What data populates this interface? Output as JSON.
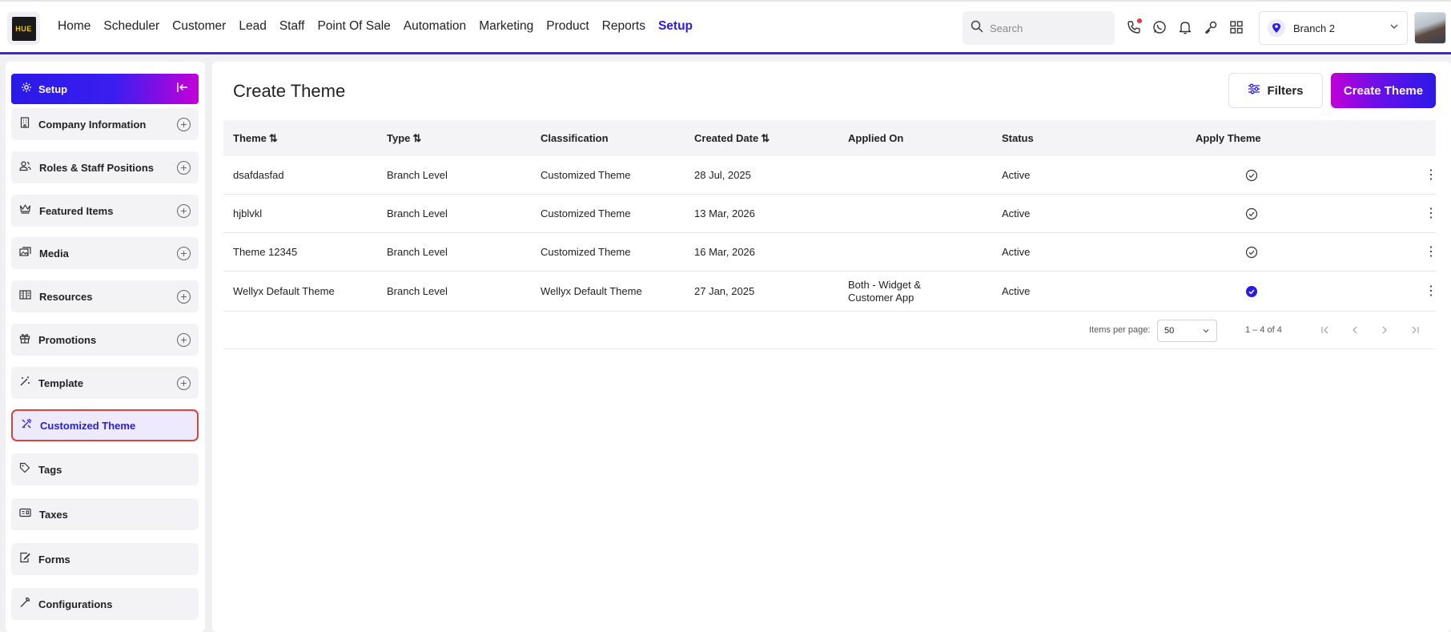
{
  "logo": {
    "text": "HUE"
  },
  "nav": {
    "items": [
      "Home",
      "Scheduler",
      "Customer",
      "Lead",
      "Staff",
      "Point Of Sale",
      "Automation",
      "Marketing",
      "Product",
      "Reports",
      "Setup"
    ],
    "active": "Setup"
  },
  "search": {
    "placeholder": "Search"
  },
  "branch": {
    "label": "Branch 2"
  },
  "sidebar": {
    "header": "Setup",
    "items": [
      {
        "label": "Company Information",
        "icon": "building-icon",
        "expandable": true
      },
      {
        "label": "Roles & Staff Positions",
        "icon": "users-icon",
        "expandable": true
      },
      {
        "label": "Featured Items",
        "icon": "crown-icon",
        "expandable": true
      },
      {
        "label": "Media",
        "icon": "images-icon",
        "expandable": true
      },
      {
        "label": "Resources",
        "icon": "resources-icon",
        "expandable": true
      },
      {
        "label": "Promotions",
        "icon": "gift-icon",
        "expandable": true
      },
      {
        "label": "Template",
        "icon": "wand-icon",
        "expandable": true
      },
      {
        "label": "Customized Theme",
        "icon": "theme-icon",
        "expandable": false,
        "active": true
      },
      {
        "label": "Tags",
        "icon": "tag-icon",
        "expandable": false
      },
      {
        "label": "Taxes",
        "icon": "receipt-icon",
        "expandable": false
      },
      {
        "label": "Forms",
        "icon": "form-icon",
        "expandable": false
      },
      {
        "label": "Configurations",
        "icon": "wrench-icon",
        "expandable": false
      }
    ]
  },
  "main": {
    "title": "Create Theme",
    "filters_label": "Filters",
    "create_label": "Create Theme",
    "columns": [
      "Theme",
      "Type",
      "Classification",
      "Created Date",
      "Applied On",
      "Status",
      "Apply Theme"
    ],
    "rows": [
      {
        "theme": "dsafdasfad",
        "type": "Branch Level",
        "classification": "Customized Theme",
        "created": "28 Jul, 2025",
        "applied_on": "",
        "status": "Active",
        "applied": false
      },
      {
        "theme": "hjblvkl",
        "type": "Branch Level",
        "classification": "Customized Theme",
        "created": "13 Mar, 2026",
        "applied_on": "",
        "status": "Active",
        "applied": false
      },
      {
        "theme": "Theme 12345",
        "type": "Branch Level",
        "classification": "Customized Theme",
        "created": "16 Mar, 2026",
        "applied_on": "",
        "status": "Active",
        "applied": false
      },
      {
        "theme": "Wellyx Default Theme",
        "type": "Branch Level",
        "classification": "Wellyx Default Theme",
        "created": "27 Jan, 2025",
        "applied_on": "Both - Widget & Customer App",
        "status": "Active",
        "applied": true
      }
    ],
    "pager": {
      "items_per_page_label": "Items per page:",
      "items_per_page": "50",
      "range": "1 – 4 of 4"
    }
  },
  "colors": {
    "accent": "#2a1ae8",
    "gradient_end": "#c400d8",
    "active_border": "#d9433c"
  }
}
